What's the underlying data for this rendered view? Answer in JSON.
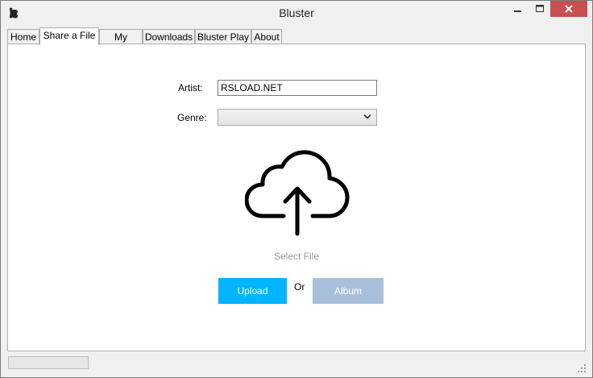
{
  "window": {
    "title": "Bluster",
    "app_icon": "bluster-logo-icon",
    "controls": [
      "minimize-icon",
      "maximize-icon",
      "close-icon"
    ],
    "close_color": "#c75050"
  },
  "tabs": [
    {
      "label": "Home",
      "active": false
    },
    {
      "label": "Share a File",
      "active": true
    },
    {
      "label": "My Folder",
      "active": false
    },
    {
      "label": "Downloads",
      "active": false
    },
    {
      "label": "Bluster Play",
      "active": false
    },
    {
      "label": "About",
      "active": false
    }
  ],
  "form": {
    "artist_label": "Artist:",
    "artist_value": "RSLOAD.NET",
    "genre_label": "Genre:",
    "genre_value": ""
  },
  "upload_area": {
    "icon": "cloud-upload-icon",
    "select_file_label": "Select File"
  },
  "actions": {
    "upload_label": "Upload",
    "or_label": "Or",
    "album_label": "Album",
    "upload_color": "#00b4ff",
    "album_color": "#a8bfdc"
  },
  "statusbar": {
    "progress": 0
  }
}
